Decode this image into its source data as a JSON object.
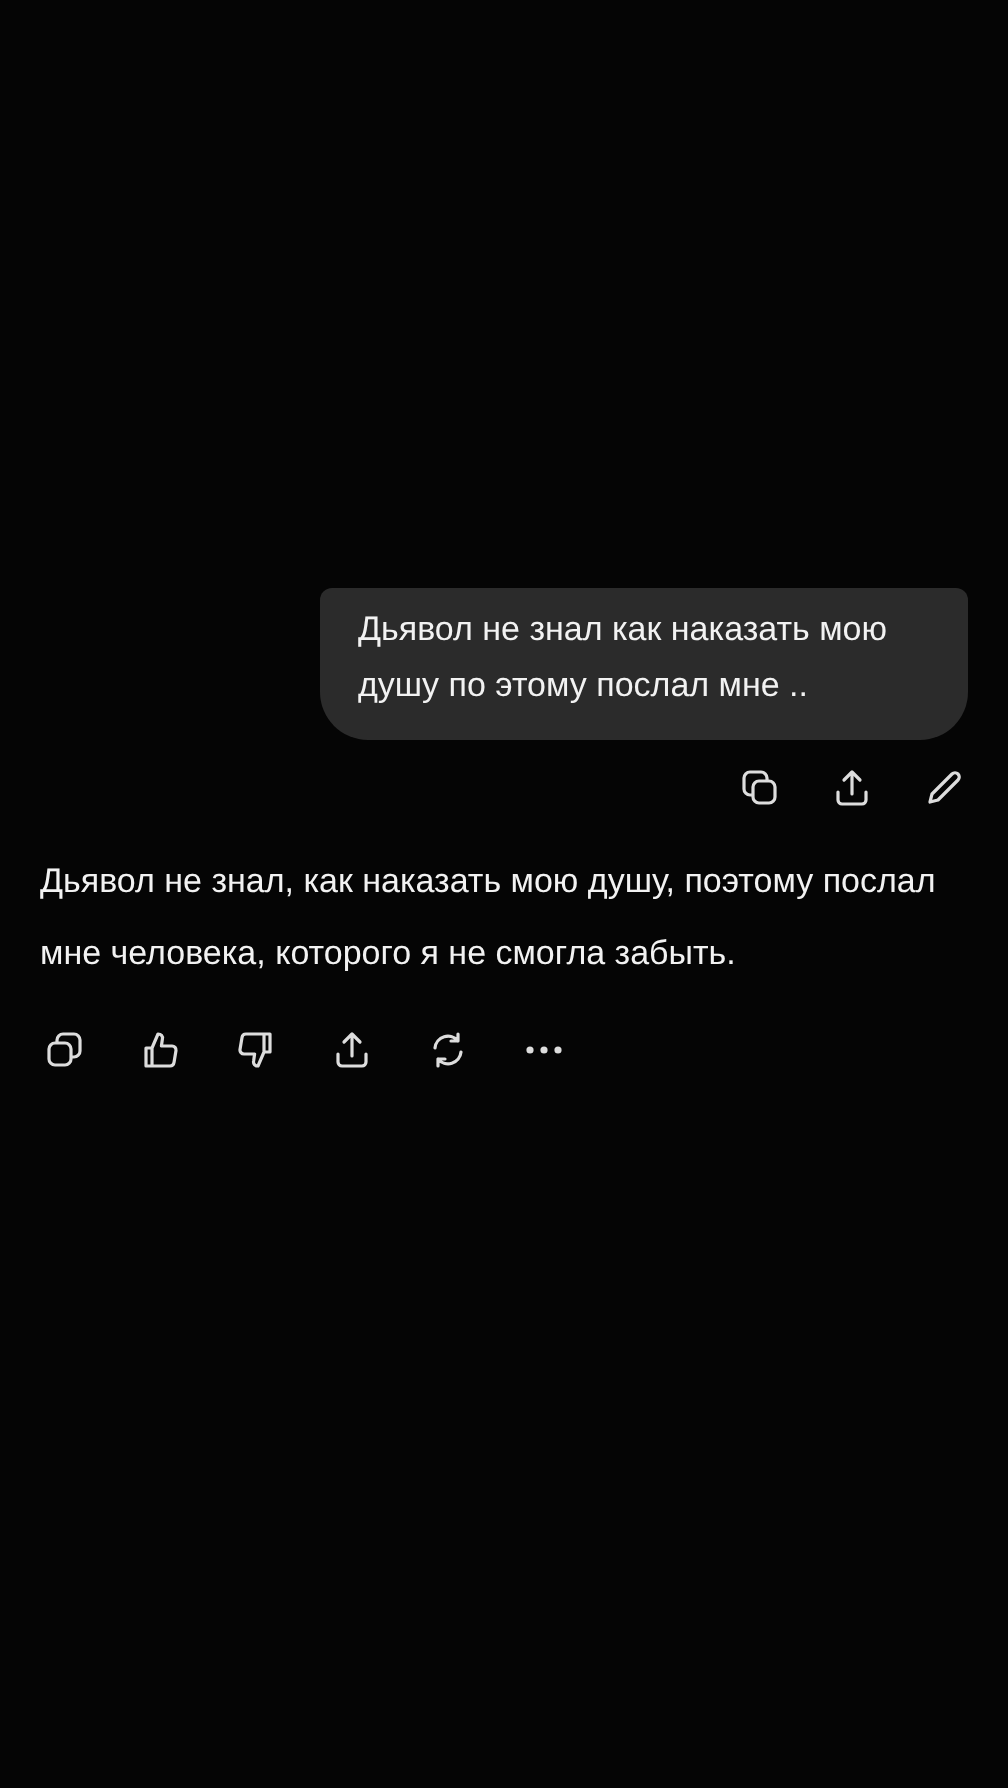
{
  "user_message": {
    "text": "Дьявол не знал как наказать мою душу по этому послал мне ..",
    "actions": [
      {
        "kind": "copy"
      },
      {
        "kind": "share"
      },
      {
        "kind": "edit"
      }
    ]
  },
  "assistant_message": {
    "text": "Дьявол не знал, как наказать мою душу, поэтому послал мне человека, которого я не смогла забыть.",
    "actions": [
      {
        "kind": "copy"
      },
      {
        "kind": "like"
      },
      {
        "kind": "dislike"
      },
      {
        "kind": "share"
      },
      {
        "kind": "regenerate"
      },
      {
        "kind": "more"
      }
    ]
  }
}
